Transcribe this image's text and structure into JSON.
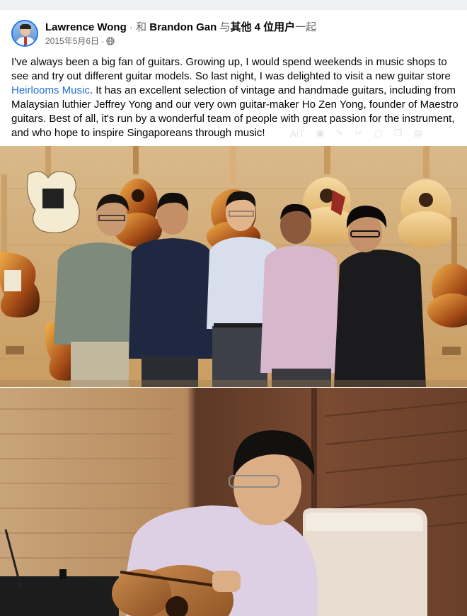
{
  "post": {
    "author": "Lawrence Wong",
    "separator": " · 和 ",
    "tagged": "Brandon Gan",
    "with_text": " 与",
    "others": "其他 4 位用户",
    "suffix": "一起",
    "date": "2015年5月6日",
    "date_sep": "·",
    "body_before_link": "I've always been a big fan of guitars. Growing up, I would spend weekends in music shops to see and try out different guitar models. So last night, I was delighted to visit a new guitar store ",
    "link_text": "Heirlooms Music",
    "body_after_link": ". It has an excellent selection of vintage and handmade guitars, including from Malaysian luthier Jeffrey Yong and our very own guitar-maker Ho Zen Yong, founder of Maestro guitars. Best of all, it's run by a wonderful team of people with great passion for the instrument, and who hope to inspire Singaporeans through music!",
    "toolbar_glyph": "AIT"
  },
  "colors": {
    "link": "#216fdb",
    "name_text": "#050505",
    "meta_text": "#65676b",
    "avatar_border": "#1877f2"
  },
  "icons": {
    "privacy": "globe-icon",
    "avatar": "profile-photo"
  },
  "photos": [
    {
      "subject": "five men standing in front of a wall of guitars"
    },
    {
      "subject": "man in glasses playing an acoustic guitar, seated"
    }
  ]
}
